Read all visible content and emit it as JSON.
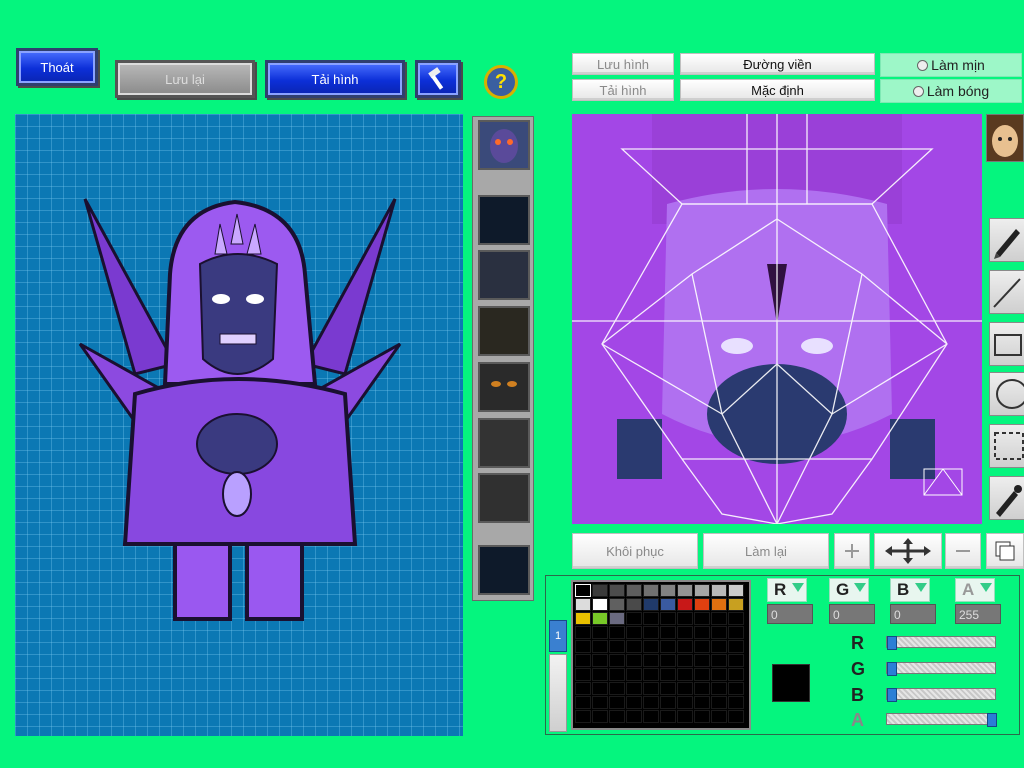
{
  "toolbar": {
    "exit_label": "Thoát",
    "save_label": "Lưu lại",
    "reload_label": "Tải hình",
    "help_glyph": "?"
  },
  "right_toolbar": {
    "save_image_label": "Lưu hình",
    "reload_image_label": "Tải hình",
    "outline_label": "Đường viền",
    "default_label": "Mặc định",
    "smooth_label": "Làm mịn",
    "shade_label": "Làm bóng"
  },
  "edit_actions": {
    "restore_label": "Khôi phục",
    "redo_label": "Làm lại"
  },
  "palette": {
    "tab_label": "1",
    "colors": [
      "#000000",
      "#3a3a3a",
      "#4c4c4c",
      "#5e5e5e",
      "#707070",
      "#828282",
      "#949494",
      "#a6a6a6",
      "#b8b8b8",
      "#cacaca",
      "#dcdcdc",
      "#ffffff",
      "#606060",
      "#4a4a4a",
      "#203a6a",
      "#3a5aa0",
      "#c81818",
      "#e04010",
      "#e07010",
      "#c8a020",
      "#e8c000",
      "#78c828",
      "#6a6a80"
    ]
  },
  "color_channels": {
    "r_label": "R",
    "g_label": "G",
    "b_label": "B",
    "a_label": "A",
    "r_value": "0",
    "g_value": "0",
    "b_value": "0",
    "a_value": "255",
    "slider_fractions": {
      "r": 0,
      "g": 0,
      "b": 0,
      "a": 1
    },
    "current_color": "#000000"
  },
  "icons": [
    "hammer-icon",
    "help-icon",
    "pencil-icon",
    "line-icon",
    "rectangle-icon",
    "ellipse-icon",
    "select-icon",
    "eyedropper-icon",
    "move-icon",
    "plus-icon",
    "minus-icon",
    "copy-icon"
  ],
  "colors": {
    "background": "#05f57e",
    "preview_bg": "#0b78b4",
    "texture_bg": "#a347e6",
    "accent_blue": "#0c2fd8"
  }
}
